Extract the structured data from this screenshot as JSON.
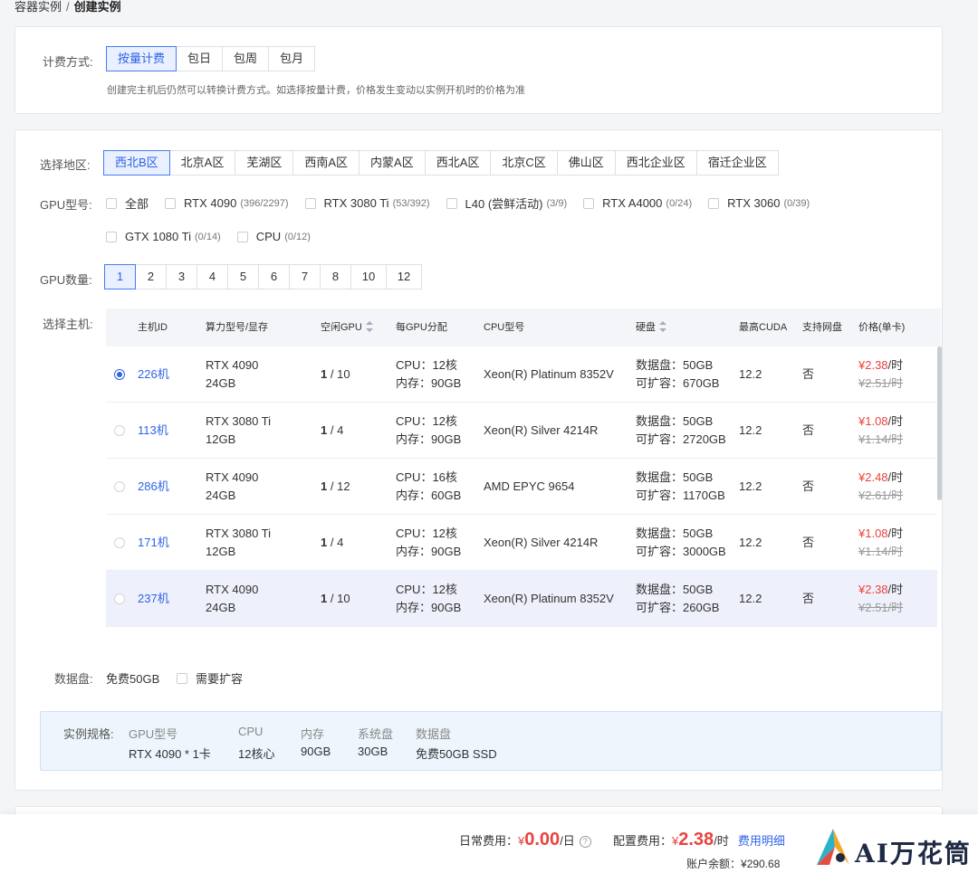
{
  "breadcrumb": {
    "parent": "容器实例",
    "sep": "/",
    "current": "创建实例"
  },
  "billing": {
    "label": "计费方式:",
    "options": [
      "按量计费",
      "包日",
      "包周",
      "包月"
    ],
    "selected": 0,
    "hint": "创建完主机后仍然可以转换计费方式。如选择按量计费，价格发生变动以实例开机时的价格为准"
  },
  "region": {
    "label": "选择地区:",
    "options": [
      "西北B区",
      "北京A区",
      "芜湖区",
      "西南A区",
      "内蒙A区",
      "西北A区",
      "北京C区",
      "佛山区",
      "西北企业区",
      "宿迁企业区"
    ],
    "selected": 0
  },
  "gpu_model": {
    "label": "GPU型号:",
    "options": [
      {
        "name": "全部",
        "count": ""
      },
      {
        "name": "RTX 4090",
        "count": "(396/2297)"
      },
      {
        "name": "RTX 3080 Ti",
        "count": "(53/392)"
      },
      {
        "name": "L40 (尝鲜活动)",
        "count": "(3/9)"
      },
      {
        "name": "RTX A4000",
        "count": "(0/24)"
      },
      {
        "name": "RTX 3060",
        "count": "(0/39)"
      },
      {
        "name": "GTX 1080 Ti",
        "count": "(0/14)"
      },
      {
        "name": "CPU",
        "count": "(0/12)"
      }
    ]
  },
  "gpu_count": {
    "label": "GPU数量:",
    "options": [
      "1",
      "2",
      "3",
      "4",
      "5",
      "6",
      "7",
      "8",
      "10",
      "12"
    ],
    "selected": 0
  },
  "host": {
    "label": "选择主机:",
    "columns": [
      "主机ID",
      "算力型号/显存",
      "空闲GPU",
      "每GPU分配",
      "CPU型号",
      "硬盘",
      "最高CUDA",
      "支持网盘",
      "价格(单卡)"
    ],
    "rows": [
      {
        "id": "226机",
        "model": "RTX 4090",
        "vram": "24GB",
        "free": "1",
        "total": "/ 10",
        "cpu": "CPU：12核",
        "mem": "内存：90GB",
        "cpu_model": "Xeon(R) Platinum 8352V",
        "disk": "数据盘：50GB",
        "expand": "可扩容：670GB",
        "cuda": "12.2",
        "netdisk": "否",
        "price": "¥2.38",
        "unit": "/时",
        "old": "¥2.51/时",
        "selected": true
      },
      {
        "id": "113机",
        "model": "RTX 3080 Ti",
        "vram": "12GB",
        "free": "1",
        "total": "/ 4",
        "cpu": "CPU：12核",
        "mem": "内存：90GB",
        "cpu_model": "Xeon(R) Silver 4214R",
        "disk": "数据盘：50GB",
        "expand": "可扩容：2720GB",
        "cuda": "12.2",
        "netdisk": "否",
        "price": "¥1.08",
        "unit": "/时",
        "old": "¥1.14/时",
        "selected": false
      },
      {
        "id": "286机",
        "model": "RTX 4090",
        "vram": "24GB",
        "free": "1",
        "total": "/ 12",
        "cpu": "CPU：16核",
        "mem": "内存：60GB",
        "cpu_model": "AMD EPYC 9654",
        "disk": "数据盘：50GB",
        "expand": "可扩容：1170GB",
        "cuda": "12.2",
        "netdisk": "否",
        "price": "¥2.48",
        "unit": "/时",
        "old": "¥2.61/时",
        "selected": false
      },
      {
        "id": "171机",
        "model": "RTX 3080 Ti",
        "vram": "12GB",
        "free": "1",
        "total": "/ 4",
        "cpu": "CPU：12核",
        "mem": "内存：90GB",
        "cpu_model": "Xeon(R) Silver 4214R",
        "disk": "数据盘：50GB",
        "expand": "可扩容：3000GB",
        "cuda": "12.2",
        "netdisk": "否",
        "price": "¥1.08",
        "unit": "/时",
        "old": "¥1.14/时",
        "selected": false
      },
      {
        "id": "237机",
        "model": "RTX 4090",
        "vram": "24GB",
        "free": "1",
        "total": "/ 10",
        "cpu": "CPU：12核",
        "mem": "内存：90GB",
        "cpu_model": "Xeon(R) Platinum 8352V",
        "disk": "数据盘：50GB",
        "expand": "可扩容：260GB",
        "cuda": "12.2",
        "netdisk": "否",
        "price": "¥2.38",
        "unit": "/时",
        "old": "¥2.51/时",
        "selected": false
      }
    ]
  },
  "data_disk": {
    "label": "数据盘:",
    "value": "免费50GB",
    "expand_label": "需要扩容"
  },
  "spec": {
    "label": "实例规格:",
    "items": [
      {
        "key": "GPU型号",
        "value": "RTX 4090 * 1卡"
      },
      {
        "key": "CPU",
        "value": "12核心"
      },
      {
        "key": "内存",
        "value": "90GB"
      },
      {
        "key": "系统盘",
        "value": "30GB"
      },
      {
        "key": "数据盘",
        "value": "免费50GB SSD"
      }
    ]
  },
  "footer": {
    "daily_label": "日常费用：",
    "daily_yen": "¥",
    "daily_value": "0.00",
    "daily_unit": "/日",
    "help": "?",
    "config_label": "配置费用：",
    "config_yen": "¥",
    "config_value": "2.38",
    "config_unit": "/时",
    "detail_link": "费用明细",
    "balance_label": "账户余额：",
    "balance_value": "¥290.68"
  },
  "logo": {
    "text": "AI万花筒"
  },
  "colors": {
    "accent": "#2f63e6",
    "price": "#e9433e",
    "accent_bg": "#e9f0ff"
  }
}
